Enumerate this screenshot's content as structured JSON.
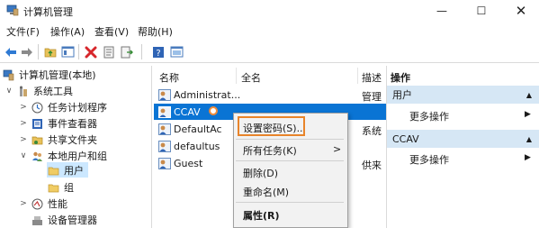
{
  "window": {
    "title": "计算机管理",
    "minimize_glyph": "—",
    "maximize_glyph": "☐",
    "close_glyph": "✕"
  },
  "menubar": [
    "文件(F)",
    "操作(A)",
    "查看(V)",
    "帮助(H)"
  ],
  "toolbar": {
    "icons": [
      "back-arrow-icon",
      "forward-arrow-icon",
      "up-folder-icon",
      "show-hide-tree-icon",
      "delete-icon",
      "properties-icon",
      "export-list-icon",
      "help-icon",
      "mmc-view-icon"
    ]
  },
  "tree": {
    "items": [
      {
        "label": "计算机管理(本地)",
        "chevron": "",
        "icon": "computer-management-icon"
      },
      {
        "label": "系统工具",
        "chevron": "∨",
        "icon": "system-tools-icon"
      },
      {
        "label": "任务计划程序",
        "chevron": ">",
        "icon": "clock-icon"
      },
      {
        "label": "事件查看器",
        "chevron": ">",
        "icon": "event-viewer-icon"
      },
      {
        "label": "共享文件夹",
        "chevron": ">",
        "icon": "shared-folder-icon"
      },
      {
        "label": "本地用户和组",
        "chevron": "∨",
        "icon": "users-groups-icon"
      },
      {
        "label": "用户",
        "chevron": "",
        "icon": "folder-icon"
      },
      {
        "label": "组",
        "chevron": "",
        "icon": "folder-icon"
      },
      {
        "label": "性能",
        "chevron": ">",
        "icon": "performance-icon"
      },
      {
        "label": "设备管理器",
        "chevron": "",
        "icon": "device-manager-icon"
      }
    ]
  },
  "list": {
    "columns": [
      "名称",
      "全名",
      "描述"
    ],
    "rows": [
      {
        "name": "Administrat...",
        "fullname": "",
        "desc": "管理"
      },
      {
        "name": "CCAV",
        "fullname": "",
        "desc": ""
      },
      {
        "name": "DefaultAc",
        "fullname": "",
        "desc": "系统"
      },
      {
        "name": "defaultus",
        "fullname": "",
        "desc": ""
      },
      {
        "name": "Guest",
        "fullname": "",
        "desc": "供来"
      }
    ]
  },
  "actions": {
    "header": "操作",
    "sections": [
      {
        "title": "用户",
        "item": "更多操作"
      },
      {
        "title": "CCAV",
        "item": "更多操作"
      }
    ]
  },
  "context_menu": {
    "items": [
      "设置密码(S)...",
      "所有任务(K)",
      "删除(D)",
      "重命名(M)",
      "属性(R)"
    ],
    "submenu_arrow": ">"
  },
  "colors": {
    "selection_blue": "#0a74d4",
    "highlight_orange": "#e8842a",
    "actions_header": "#d6e7f5"
  }
}
